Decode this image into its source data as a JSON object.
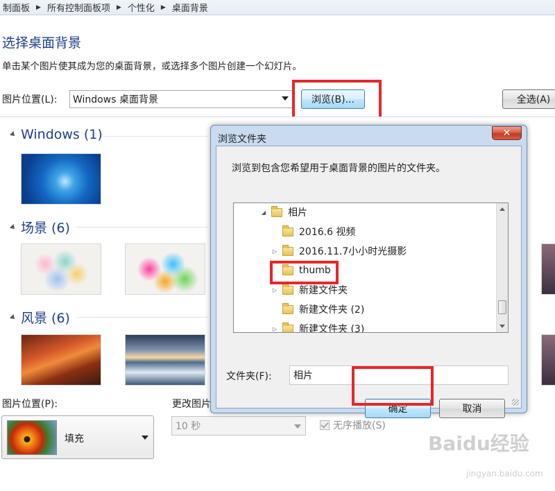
{
  "breadcrumb": [
    "制面板",
    "所有控制面板项",
    "个性化",
    "桌面背景"
  ],
  "heading": "选择桌面背景",
  "subtext": "单击某个图片使其成为您的桌面背景，或选择多个图片创建一个幻灯片。",
  "location": {
    "label": "图片位置(L):",
    "value": "Windows 桌面背景"
  },
  "buttons": {
    "browse": "浏览(B)...",
    "select_all": "全选(A)"
  },
  "groups": [
    {
      "name": "Windows (1)"
    },
    {
      "name": "场景 (6)"
    },
    {
      "name": "风景 (6)"
    }
  ],
  "bottom": {
    "position_label": "图片位置(P):",
    "position_value": "填充",
    "change_label": "更改图片",
    "interval_value": "10 秒",
    "shuffle_label": "无序播放(S)"
  },
  "dialog": {
    "title": "浏览文件夹",
    "close": "✕",
    "description": "浏览到包含您希望用于桌面背景的图片的文件夹。",
    "tree": [
      {
        "label": "相片",
        "expander": "◢"
      },
      {
        "label": "2016.6 视频",
        "expander": ""
      },
      {
        "label": "2016.11.7小小时光摄影",
        "expander": "▷"
      },
      {
        "label": "thumb",
        "expander": ""
      },
      {
        "label": "新建文件夹",
        "expander": "▷"
      },
      {
        "label": "新建文件夹 (2)",
        "expander": ""
      },
      {
        "label": "新建文件夹 (3)",
        "expander": "▷"
      }
    ],
    "folder_label": "文件夹(F):",
    "folder_value": "相片",
    "ok": "确定",
    "cancel": "取消"
  },
  "watermark": {
    "brand": "Baidu经验",
    "url": "jingyan.baidu.com"
  },
  "colors": {
    "heading": "#1d3f8c",
    "highlight_box": "#e8262a",
    "dialog_frame": "#c8dbef"
  }
}
